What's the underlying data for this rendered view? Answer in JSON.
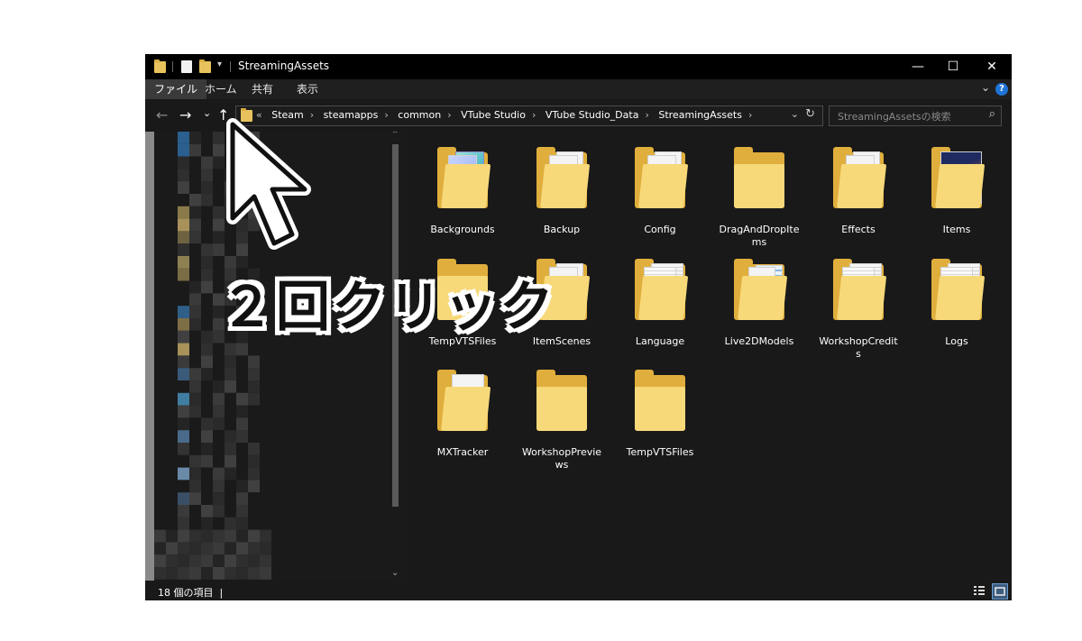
{
  "window": {
    "title": "StreamingAssets",
    "controls": {
      "minimize": "—",
      "maximize": "☐",
      "close": "✕"
    }
  },
  "ribbon": {
    "tabs": [
      {
        "label": "ファイル",
        "active": true
      },
      {
        "label": "ホーム"
      },
      {
        "label": "共有"
      },
      {
        "label": "表示"
      }
    ],
    "help": "?"
  },
  "nav": {
    "back": "←",
    "forward": "→",
    "recent": "⌄",
    "up": "↑",
    "overflow": "«",
    "breadcrumbs": [
      "Steam",
      "steamapps",
      "common",
      "VTube Studio",
      "VTube Studio_Data",
      "StreamingAssets"
    ],
    "sep": "›",
    "search_placeholder": "StreamingAssetsの検索"
  },
  "items": [
    {
      "label": "Backgrounds",
      "type": "bg"
    },
    {
      "label": "Backup",
      "type": "doc"
    },
    {
      "label": "Config",
      "type": "doc"
    },
    {
      "label": "DragAndDropItems",
      "type": "empty"
    },
    {
      "label": "Effects",
      "type": "doc"
    },
    {
      "label": "Items",
      "type": "img"
    },
    {
      "label": "TempVTSFiles",
      "type": "empty"
    },
    {
      "label": "ItemScenes",
      "type": "doc"
    },
    {
      "label": "Language",
      "type": "text"
    },
    {
      "label": "Live2DModels",
      "type": "mixed"
    },
    {
      "label": "WorkshopCredits",
      "type": "text"
    },
    {
      "label": "Logs",
      "type": "text"
    },
    {
      "label": "MXTracker",
      "type": "gear"
    },
    {
      "label": "WorkshopPreviews",
      "type": "empty"
    },
    {
      "label": "TempVTSFiles",
      "type": "empty"
    }
  ],
  "status": {
    "count": "18 個の項目",
    "caret": "|"
  },
  "overlay": {
    "text": "２回クリック"
  },
  "colors": {
    "folder_back": "#e0ae3c",
    "folder_front": "#f7d97a",
    "accent": "#1e74d6"
  }
}
